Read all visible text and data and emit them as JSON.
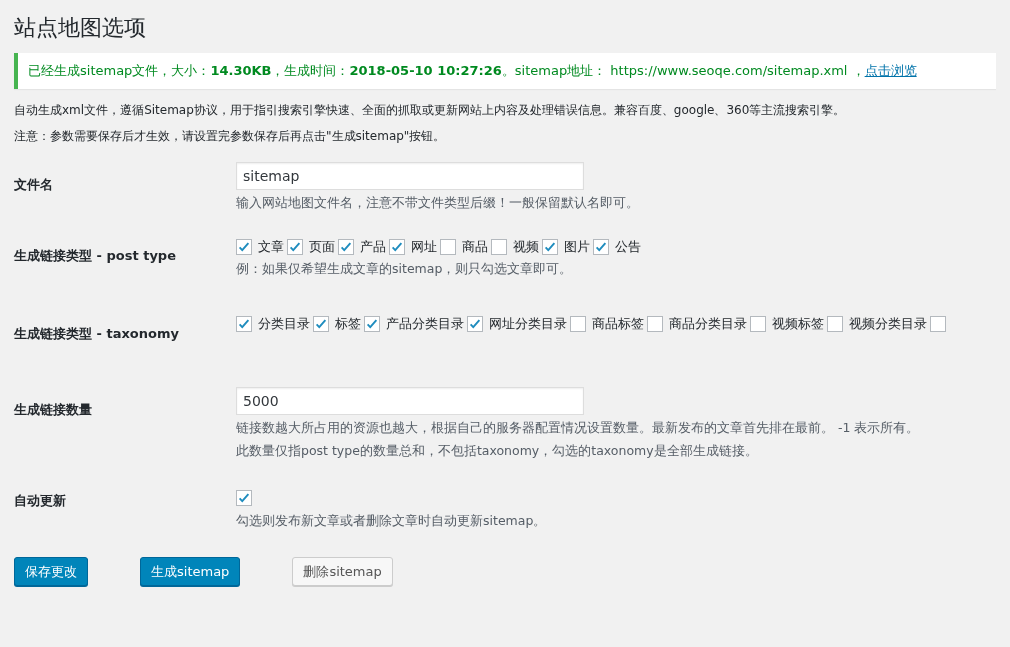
{
  "title": "站点地图选项",
  "notice": {
    "text": "已经生成sitemap文件，大小：**14.30KB**，生成时间：**2018-05-10 10:27:26**。sitemap地址： https://www.seoqe.com/sitemap.xml ，",
    "link": "点击浏览"
  },
  "intro": [
    "自动生成xml文件，遵循Sitemap协议，用于指引搜索引擎快速、全面的抓取或更新网站上内容及处理错误信息。兼容百度、google、360等主流搜索引擎。",
    "注意：参数需要保存后才生效，请设置完参数保存后再点击\"生成sitemap\"按钮。"
  ],
  "fields": [
    {
      "kind": "text",
      "label": "文件名",
      "value": "sitemap",
      "help": [
        "输入网站地图文件名，注意不带文件类型后缀！一般保留默认名即可。"
      ]
    },
    {
      "kind": "checks",
      "label": "生成链接类型 - post type",
      "options": [
        {
          "label": "文章",
          "checked": true
        },
        {
          "label": "页面",
          "checked": true
        },
        {
          "label": "产品",
          "checked": true
        },
        {
          "label": "网址",
          "checked": true
        },
        {
          "label": "商品",
          "checked": false
        },
        {
          "label": "视频",
          "checked": false
        },
        {
          "label": "图片",
          "checked": true
        },
        {
          "label": "公告",
          "checked": true
        }
      ],
      "help": [
        "例：如果仅希望生成文章的sitemap，则只勾选文章即可。"
      ]
    },
    {
      "kind": "checks",
      "label": "生成链接类型 - taxonomy",
      "options": [
        {
          "label": "分类目录",
          "checked": true
        },
        {
          "label": "标签",
          "checked": true
        },
        {
          "label": "产品分类目录",
          "checked": true
        },
        {
          "label": "网址分类目录",
          "checked": true
        },
        {
          "label": "商品标签",
          "checked": false
        },
        {
          "label": "商品分类目录",
          "checked": false
        },
        {
          "label": "视频标签",
          "checked": false
        },
        {
          "label": "视频分类目录",
          "checked": false
        },
        {
          "checked": false
        }
      ]
    },
    {
      "kind": "text",
      "label": "生成链接数量",
      "value": "5000",
      "help": [
        "链接数越大所占用的资源也越大，根据自己的服务器配置情况设置数量。最新发布的文章首先排在最前。 -1 表示所有。",
        "此数量仅指post type的数量总和，不包括taxonomy，勾选的taxonomy是全部生成链接。"
      ]
    },
    {
      "kind": "check",
      "label": "自动更新",
      "checked": true,
      "help": [
        "勾选则发布新文章或者删除文章时自动更新sitemap。"
      ]
    }
  ],
  "buttons": [
    {
      "label": "保存更改",
      "kind": "primary"
    },
    {
      "label": "生成sitemap",
      "kind": "primary"
    },
    {
      "label": "删除sitemap",
      "kind": "secondary"
    }
  ]
}
